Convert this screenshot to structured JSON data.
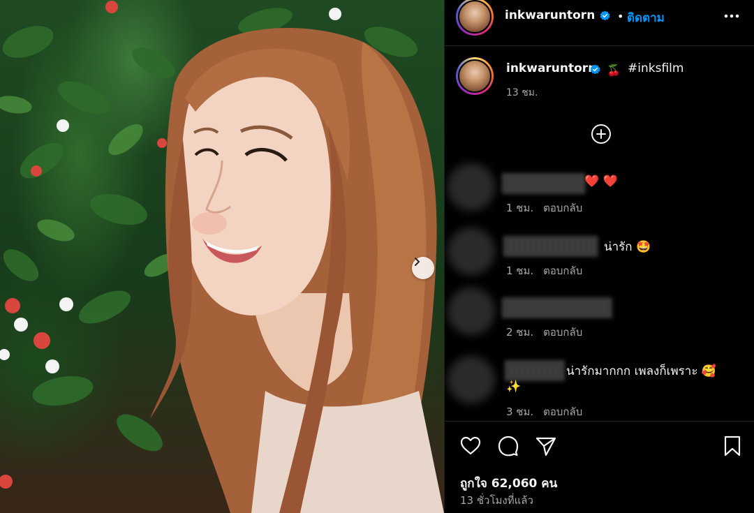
{
  "post": {
    "photo_alt": "",
    "next_icon": "chevron-right-icon"
  },
  "header": {
    "username": "inkwaruntorn",
    "verified_icon": "verified-badge-icon",
    "separator": "•",
    "follow_label": "ติดตาม",
    "more_icon": "more-horizontal-icon"
  },
  "caption": {
    "username": "inkwaruntorn",
    "emoji": "🍒",
    "text": "#inksfilm",
    "time": "13 ชม."
  },
  "load_more_icon": "plus-circle-icon",
  "comments": [
    {
      "text": "❤️ ❤️ 󠀠󠀠󠀠󠀠󠀠󠀠",
      "time": "1 ชม.",
      "reply": "ตอบกลับ"
    },
    {
      "text": "น่ารัก 🤩",
      "time": "1 ชม.",
      "reply": "ตอบกลับ"
    },
    {
      "text": "",
      "time": "2 ชม.",
      "reply": "ตอบกลับ"
    },
    {
      "text": "น่ารักมากกก เพลงก็เพราะ 🥰",
      "text2": "✨",
      "time": "3 ชม.",
      "reply": "ตอบกลับ"
    }
  ],
  "actions": {
    "like_icon": "heart-icon",
    "comment_icon": "comment-icon",
    "share_icon": "share-icon",
    "save_icon": "bookmark-icon"
  },
  "likes_text": "ถูกใจ 62,060 คน",
  "posted_time": "13 ชั่วโมงที่แล้ว",
  "colors": {
    "link_blue": "#0095f6",
    "verified_blue": "#0095f6",
    "muted": "#a8a8a8",
    "background": "#000000"
  }
}
